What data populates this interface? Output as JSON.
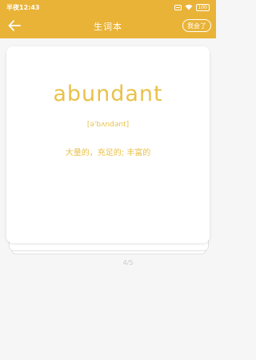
{
  "status_bar": {
    "time": "半夜12:43",
    "battery": "100"
  },
  "app_bar": {
    "title": "生词本",
    "know_button": "我会了"
  },
  "card": {
    "word": "abundant",
    "phonetic": "[ə'bʌndənt]",
    "meaning": "大量的，充足的; 丰富的"
  },
  "progress": "4/5",
  "colors": {
    "accent": "#e9b338",
    "word_text": "#e9c14a",
    "background": "#f6f6f6"
  },
  "icons": [
    "back-arrow-icon",
    "signal-icon",
    "wifi-icon",
    "sim-icon",
    "battery-icon"
  ]
}
